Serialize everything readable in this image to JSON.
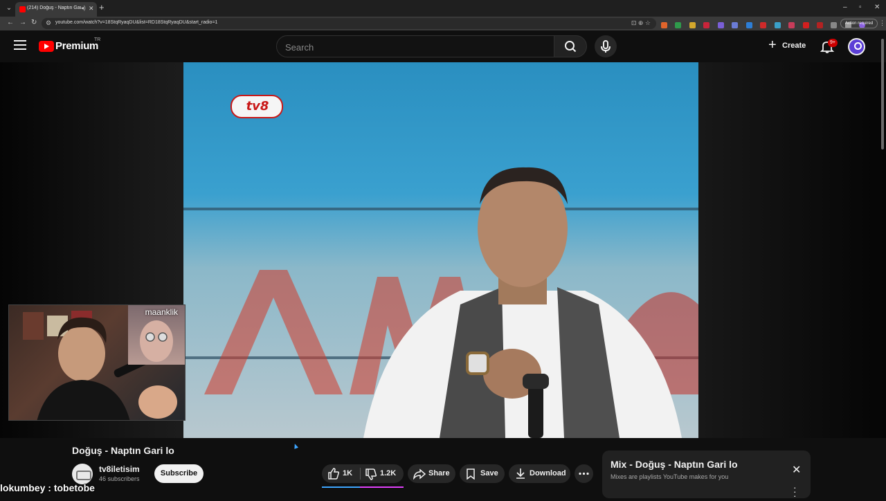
{
  "browser": {
    "tab_title": "(214) Doğuş - Naptın Gari l",
    "url": "youtube.com/watch?v=18StqRyaqDU&list=RD18StqRyaqDU&start_radio=1",
    "action_required": "Action required"
  },
  "masthead": {
    "brand": "Premium",
    "country": "TR",
    "search_placeholder": "Search",
    "create_label": "Create",
    "notifications_badge": "9+"
  },
  "video": {
    "channel_bug": "tv8",
    "webcam_tag": "maanklik",
    "title": "Doğuş - Naptın Gari lo"
  },
  "channel": {
    "name": "tv8iletisim",
    "subscribers": "46 subscribers",
    "subscribe_label": "Subscribe"
  },
  "actions": {
    "likes": "1K",
    "dislikes": "1.2K",
    "like_ratio": 0.47,
    "share": "Share",
    "save": "Save",
    "download": "Download"
  },
  "mix": {
    "title": "Mix - Doğuş - Naptın Gari lo",
    "subtitle": "Mixes are playlists YouTube makes for you"
  },
  "chat": {
    "user": "lokumbey",
    "separator": " : ",
    "message": "tobetobe"
  },
  "colors": {
    "youtube_red": "#ff0000",
    "like_bar_blue": "#3ea6ff",
    "like_bar_pink": "#e040fb",
    "background": "#0f0f0f"
  }
}
